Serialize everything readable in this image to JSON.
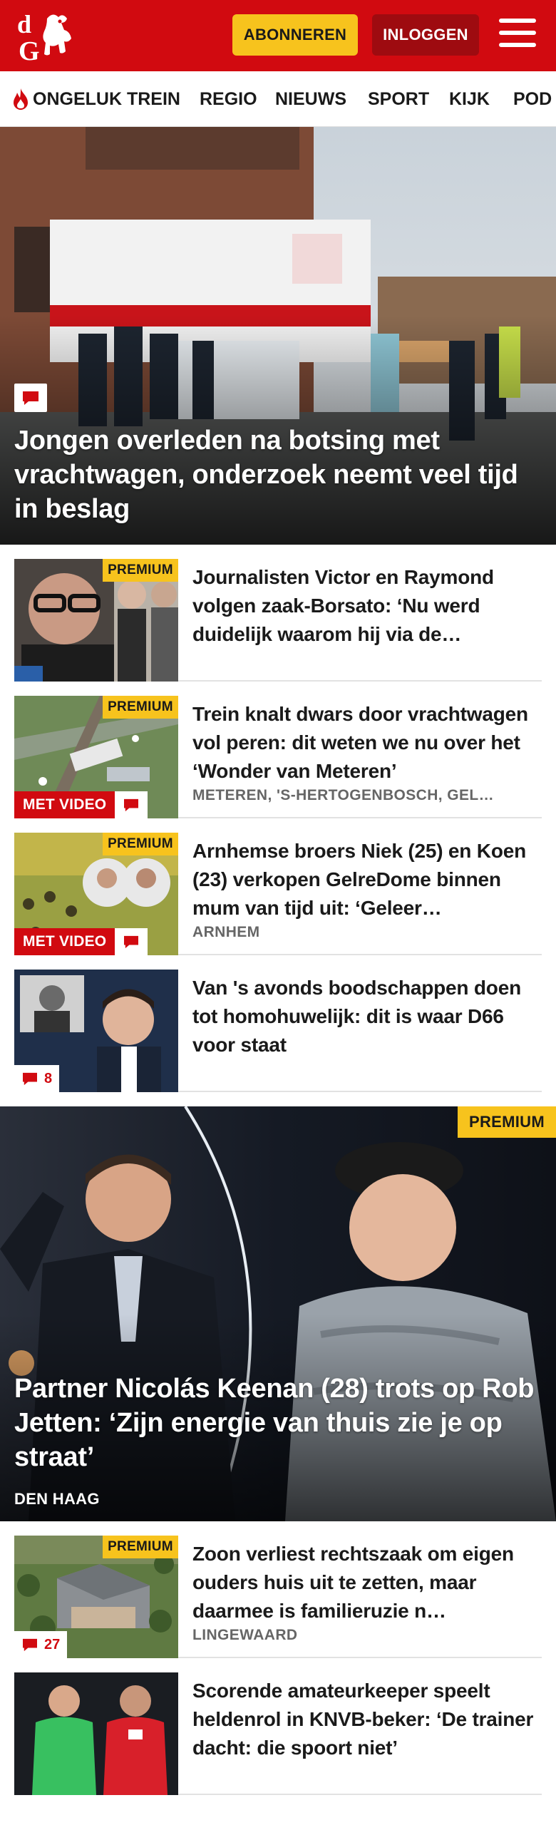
{
  "colors": {
    "brand_red": "#d10a10",
    "login_red": "#9e0b10",
    "premium_yellow": "#f7c31d",
    "meta_gray": "#666666"
  },
  "header": {
    "logo_text": "dG",
    "logo_icon": "gelderlander-horse-logo",
    "subscribe_label": "ABONNEREN",
    "login_label": "INLOGGEN",
    "menu_icon": "hamburger-menu-icon"
  },
  "nav": {
    "items": [
      {
        "label": "ONGELUK TREIN",
        "icon": "flame-icon"
      },
      {
        "label": "REGIO"
      },
      {
        "label": "NIEUWS"
      },
      {
        "label": "SPORT"
      },
      {
        "label": "KIJK"
      },
      {
        "label": "POD"
      }
    ]
  },
  "hero1": {
    "title": "Jongen overleden na botsing met vrachtwagen, onderzoek neemt veel tijd in beslag",
    "comment_icon": "comment-icon"
  },
  "articles1": [
    {
      "title": "Journalisten Victor en Raymond volgen zaak-Borsato: ‘Nu werd duidelijk waarom hij via de…",
      "premium": "PREMIUM",
      "location": ""
    },
    {
      "title": "Trein knalt dwars door vrachtwa­gen vol peren: dit weten we nu over het ‘Wonder van Meteren’",
      "premium": "PREMIUM",
      "video": "MET VIDEO",
      "location": "METEREN, 'S-HERTOGENBOSCH, GEL…"
    },
    {
      "title": "Arnhemse broers Niek (25) en Koen (23) verkopen GelreDome binnen mum van tijd uit: ‘Geleer…",
      "premium": "PREMIUM",
      "video": "MET VIDEO",
      "location": "ARNHEM"
    },
    {
      "title": "Van 's avonds boodschappen doen tot homohuwelijk: dit is waar D66 voor staat",
      "comments": "8",
      "location": ""
    }
  ],
  "hero2": {
    "premium": "PREMIUM",
    "title": "Partner Nicolás Keenan (28) trots op Rob Jetten: ‘Zijn energie van thuis zie je op straat’",
    "location": "DEN HAAG"
  },
  "articles2": [
    {
      "title": "Zoon verliest rechtszaak om eigen ouders huis uit te zetten, maar daarmee is familieruzie n…",
      "premium": "PREMIUM",
      "comments": "27",
      "location": "LINGEWAARD"
    },
    {
      "title": "Scorende amateurkeeper speelt heldenrol in KNVB-beker: ‘De trainer dacht: die spoort niet’",
      "location": ""
    }
  ]
}
